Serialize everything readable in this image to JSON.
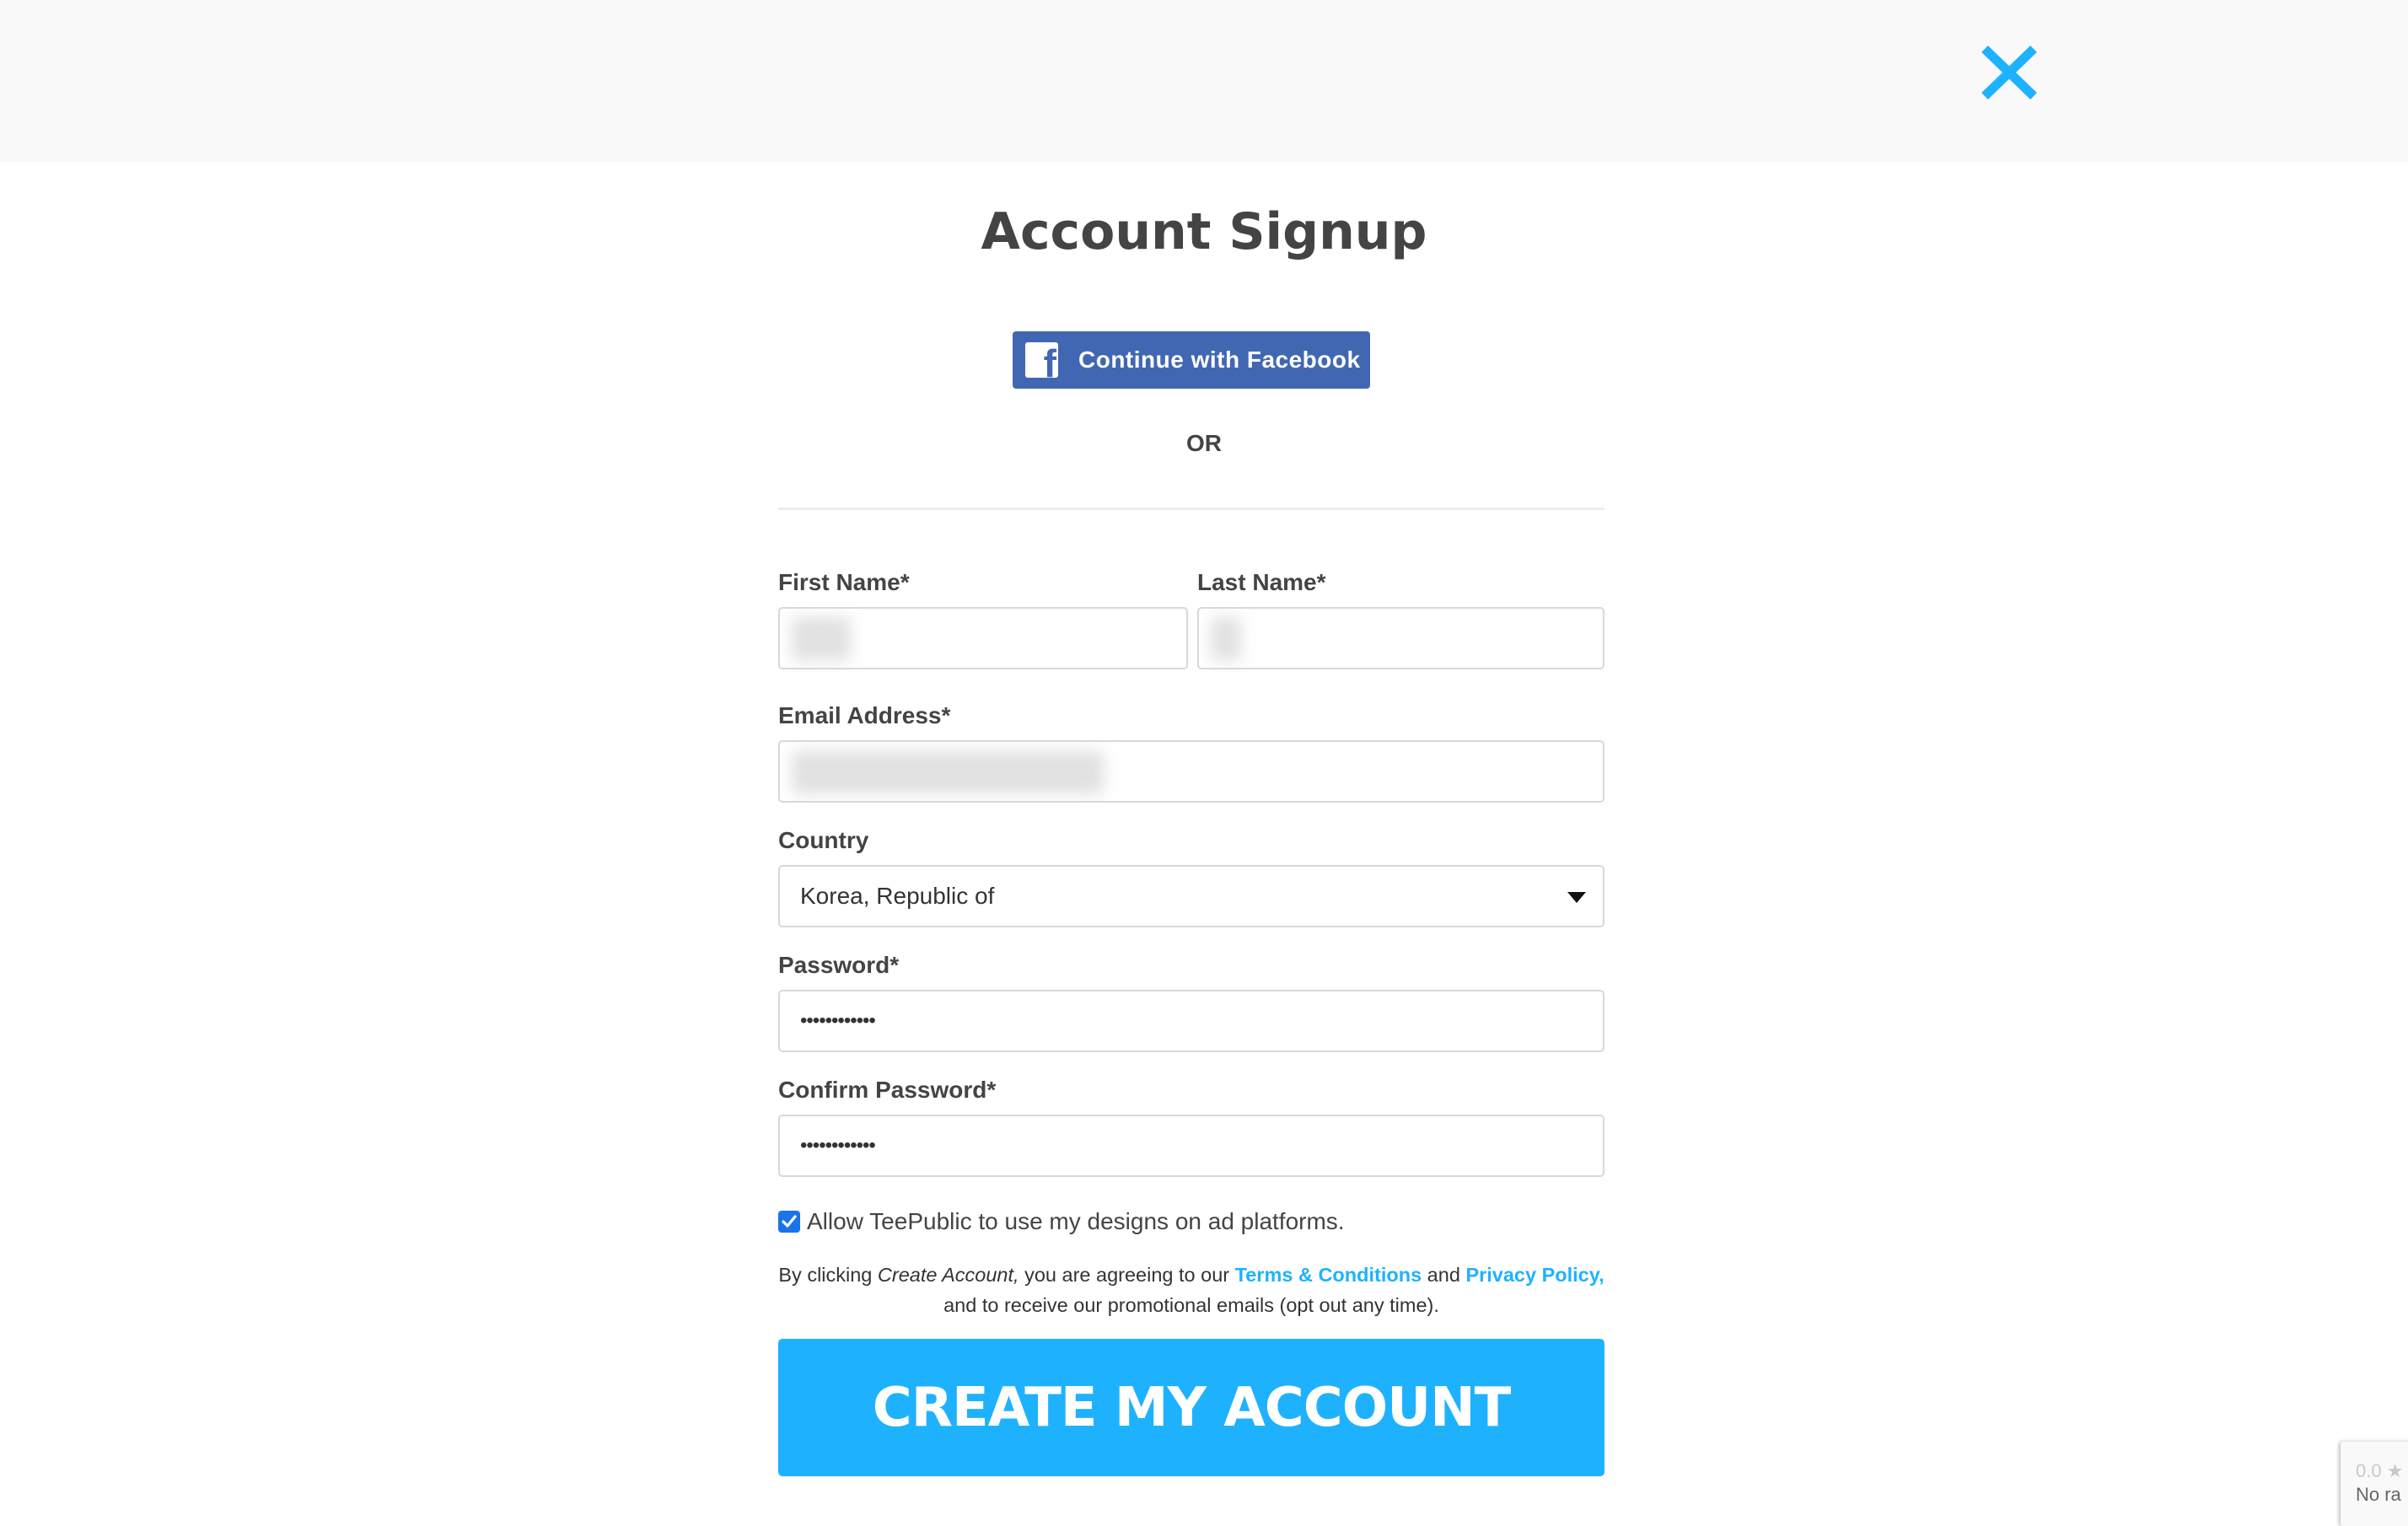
{
  "header": {
    "close_icon": "close-x-icon",
    "accent_color": "#1eb2fe"
  },
  "page": {
    "title": "Account Signup",
    "facebook_button": {
      "label": "Continue with Facebook",
      "icon": "facebook-f-icon",
      "icon_glyph": "f",
      "color": "#4267b2"
    },
    "or_label": "OR"
  },
  "form": {
    "first_name": {
      "label": "First Name*",
      "value": ""
    },
    "last_name": {
      "label": "Last Name*",
      "value": ""
    },
    "email": {
      "label": "Email Address*",
      "value": ""
    },
    "country": {
      "label": "Country",
      "selected": "Korea, Republic of"
    },
    "password": {
      "label": "Password*",
      "value": "••••••••••••"
    },
    "confirm_password": {
      "label": "Confirm Password*",
      "value": "••••••••••••"
    },
    "ad_consent": {
      "label": "Allow TeePublic to use my designs on ad platforms.",
      "checked": true
    },
    "legal": {
      "prefix": "By clicking ",
      "action_name": "Create Account,",
      "middle": " you are agreeing to our ",
      "terms_link": "Terms & Conditions",
      "and": " and ",
      "privacy_link": "Privacy Policy,",
      "suffix": " and to receive our promotional emails (opt out any time)."
    },
    "submit_label": "CREATE MY ACCOUNT",
    "submit_color": "#1eb2fe"
  },
  "rating_widget": {
    "score": "0.0 ★",
    "subtitle": "No ra"
  }
}
